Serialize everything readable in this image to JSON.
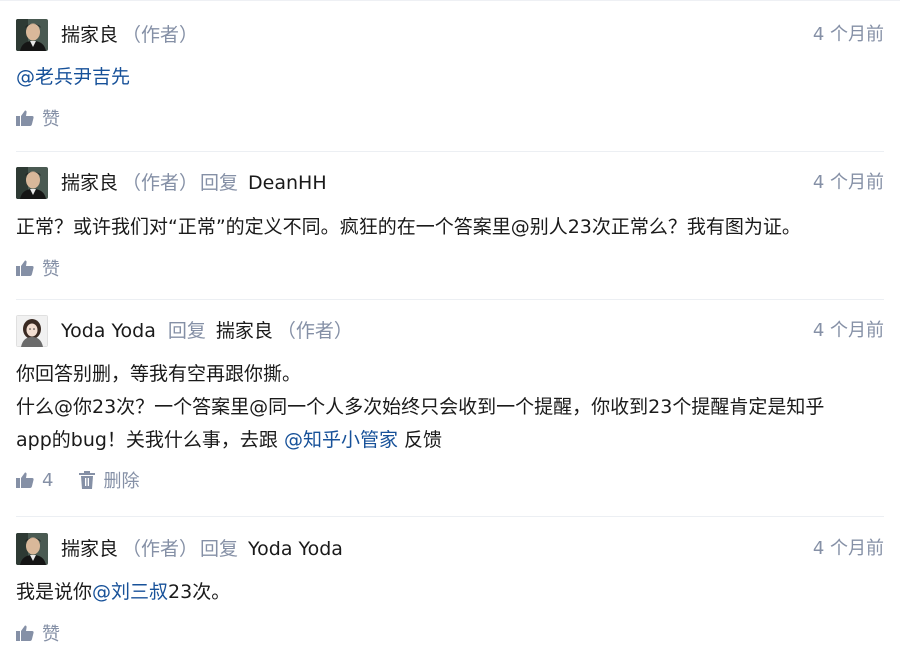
{
  "comments": [
    {
      "author": "揣家良",
      "author_tag": "（作者）",
      "time": "4 个月前",
      "mention": "@老兵尹吉先",
      "like_label": "赞"
    },
    {
      "author": "揣家良",
      "author_tag": "（作者）",
      "reply_word": "回复",
      "reply_to": "DeanHH",
      "time": "4 个月前",
      "text": "正常？或许我们对“正常”的定义不同。疯狂的在一个答案里@别人23次正常么？我有图为证。",
      "like_label": "赞"
    },
    {
      "author": "Yoda Yoda",
      "reply_word": "回复",
      "reply_to": "揣家良",
      "reply_to_tag": "（作者）",
      "time": "4 个月前",
      "line1": "你回答别删，等我有空再跟你撕。",
      "line2": "什么@你23次？一个答案里@同一个人多次始终只会收到一个提醒，你收到23个提醒肯定是知乎",
      "line3_pre": "app的bug！关我什么事，去跟 ",
      "line3_link": "@知乎小管家",
      "line3_post": " 反馈",
      "like_count": "4",
      "delete_label": "删除"
    },
    {
      "author": "揣家良",
      "author_tag": "（作者）",
      "reply_word": "回复",
      "reply_to": "Yoda Yoda",
      "time": "4 个月前",
      "text_pre": "我是说你",
      "text_link": "@刘三叔",
      "text_post": "23次。",
      "like_label": "赞"
    }
  ]
}
